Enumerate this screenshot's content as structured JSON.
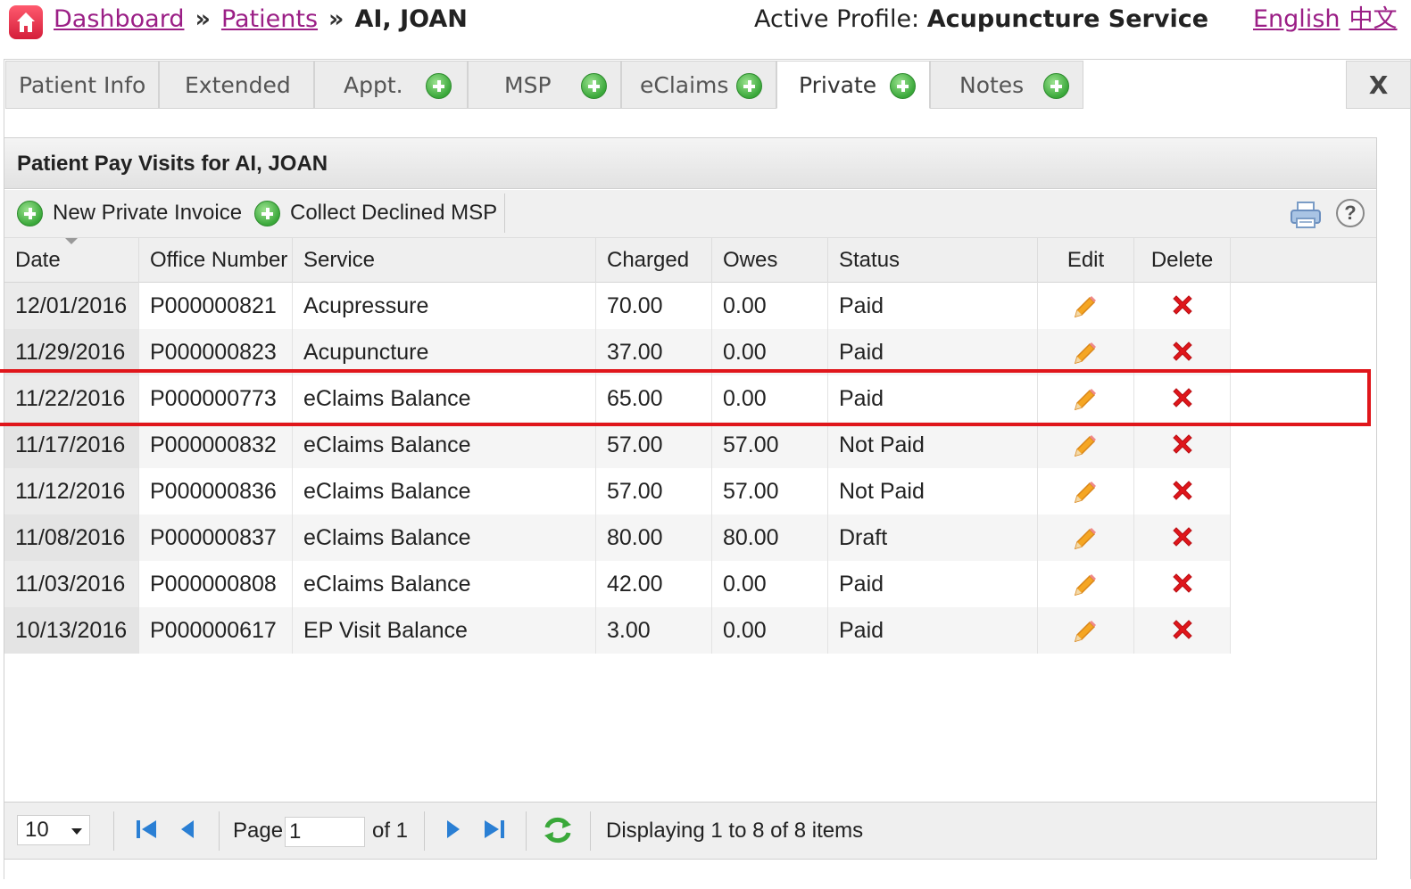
{
  "header": {
    "breadcrumb": [
      "Dashboard",
      "Patients"
    ],
    "separator": "»",
    "patient_name": "AI, JOAN",
    "profile_label": "Active Profile:",
    "profile_value": "Acupuncture Service",
    "languages": [
      "English",
      "中文"
    ]
  },
  "tabs": [
    {
      "label": "Patient Info"
    },
    {
      "label": "Extended"
    },
    {
      "label": "Appt."
    },
    {
      "label": "MSP"
    },
    {
      "label": "eClaims"
    },
    {
      "label": "Private"
    },
    {
      "label": "Notes"
    }
  ],
  "active_tab": "Private",
  "close_label": "X",
  "panel": {
    "title": "Patient Pay Visits for AI, JOAN",
    "toolbar": {
      "new_invoice": "New Private Invoice",
      "collect_declined": "Collect Declined MSP",
      "help": "?"
    }
  },
  "grid": {
    "columns": [
      "Date",
      "Office Number",
      "Service",
      "Charged",
      "Owes",
      "Status",
      "Edit",
      "Delete"
    ],
    "rows": [
      {
        "date": "12/01/2016",
        "office": "P000000821",
        "service": "Acupressure",
        "charged": "70.00",
        "owes": "0.00",
        "status": "Paid"
      },
      {
        "date": "11/29/2016",
        "office": "P000000823",
        "service": "Acupuncture",
        "charged": "37.00",
        "owes": "0.00",
        "status": "Paid"
      },
      {
        "date": "11/22/2016",
        "office": "P000000773",
        "service": "eClaims Balance",
        "charged": "65.00",
        "owes": "0.00",
        "status": "Paid"
      },
      {
        "date": "11/17/2016",
        "office": "P000000832",
        "service": "eClaims Balance",
        "charged": "57.00",
        "owes": "57.00",
        "status": "Not Paid"
      },
      {
        "date": "11/12/2016",
        "office": "P000000836",
        "service": "eClaims Balance",
        "charged": "57.00",
        "owes": "57.00",
        "status": "Not Paid"
      },
      {
        "date": "11/08/2016",
        "office": "P000000837",
        "service": "eClaims Balance",
        "charged": "80.00",
        "owes": "80.00",
        "status": "Draft"
      },
      {
        "date": "11/03/2016",
        "office": "P000000808",
        "service": "eClaims Balance",
        "charged": "42.00",
        "owes": "0.00",
        "status": "Paid"
      },
      {
        "date": "10/13/2016",
        "office": "P000000617",
        "service": "EP Visit Balance",
        "charged": "3.00",
        "owes": "0.00",
        "status": "Paid"
      }
    ],
    "highlighted_row_index": 2
  },
  "pager": {
    "page_size": "10",
    "page_label": "Page",
    "page_value": "1",
    "of_label": "of 1",
    "status_text": "Displaying 1 to 8 of 8 items"
  },
  "colors": {
    "link": "#9b1f86",
    "highlight": "#e0161b",
    "add": "#3aa83a",
    "delete": "#e0161b",
    "pager_icon": "#2a7fd4"
  }
}
